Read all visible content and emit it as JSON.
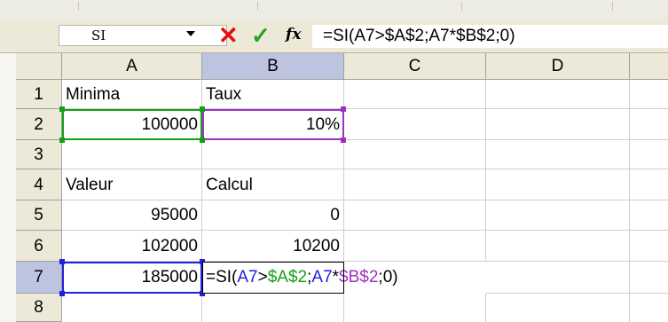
{
  "formula_bar": {
    "name_box": "SI",
    "fx_label": "fx",
    "formula": "=SI(A7>$A$2;A7*$B$2;0)"
  },
  "columns": [
    "A",
    "B",
    "C",
    "D"
  ],
  "rows": [
    "1",
    "2",
    "3",
    "4",
    "5",
    "6",
    "7",
    "8"
  ],
  "cells": {
    "A1": "Minima",
    "B1": "Taux",
    "A2": "100000",
    "B2": "10%",
    "A4": "Valeur",
    "B4": "Calcul",
    "A5": "95000",
    "B5": "0",
    "A6": "102000",
    "B6": "10200",
    "A7": "185000"
  },
  "editing": {
    "prefix": "=SI(",
    "ref1": "A7",
    "op": ">",
    "ref2": "$A$2",
    "sep": ";",
    "ref3": "A7",
    "mul": "*",
    "ref4": "$B$2",
    "suffix": ";0)"
  },
  "colors": {
    "ref_a2": "#14a014",
    "ref_b2": "#a030c0",
    "ref_a7": "#2020e0",
    "cancel": "#e01010",
    "enter": "#1fa51f",
    "active_header": "#bcc4e0"
  }
}
